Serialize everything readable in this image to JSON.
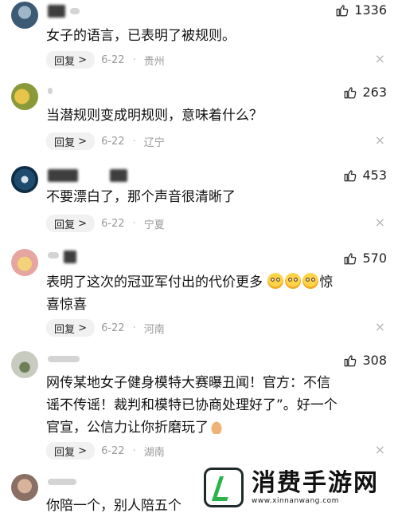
{
  "comments": [
    {
      "likes": "1336",
      "text_lines": [
        "女子的语言，已表明了被规则。"
      ],
      "reply_label": "回复",
      "reply_arrow": ">",
      "date": "6-22",
      "location": "贵州"
    },
    {
      "likes": "263",
      "text_lines": [
        "当潜规则变成明规则，意味着什么？"
      ],
      "reply_label": "回复",
      "reply_arrow": ">",
      "date": "6-22",
      "location": "辽宁"
    },
    {
      "likes": "453",
      "text_lines": [
        "不要漂白了，那个声音很清晰了"
      ],
      "reply_label": "回复",
      "reply_arrow": ">",
      "date": "6-22",
      "location": "宁夏"
    },
    {
      "likes": "570",
      "text_lines": [
        "表明了这次的冠亚军付出的代价更多",
        "喜惊喜"
      ],
      "text_suffix": "惊",
      "reply_label": "回复",
      "reply_arrow": ">",
      "date": "6-22",
      "location": "河南"
    },
    {
      "likes": "308",
      "text_lines": [
        "网传某地女子健身模特大赛曝丑闻！官方：不信",
        "谣不传谣！裁判和模特已协商处理好了”。好一个",
        "官宣，公信力让你折磨玩了"
      ],
      "reply_label": "回复",
      "reply_arrow": ">",
      "date": "6-22",
      "location": "湖南"
    },
    {
      "text_lines": [
        "你陪一个，别人陪五个"
      ]
    }
  ],
  "ui": {
    "close_symbol": "×",
    "meta_sep": "·"
  },
  "icons": {
    "like": "thumbs-up-icon",
    "close": "close-icon",
    "emoji": "flushed-face-emoji",
    "pray": "folded-hands-emoji"
  },
  "colors": {
    "meta": "#999999",
    "reply_bg": "#f1f1f1",
    "watermark_green": "#2bb34a"
  }
}
